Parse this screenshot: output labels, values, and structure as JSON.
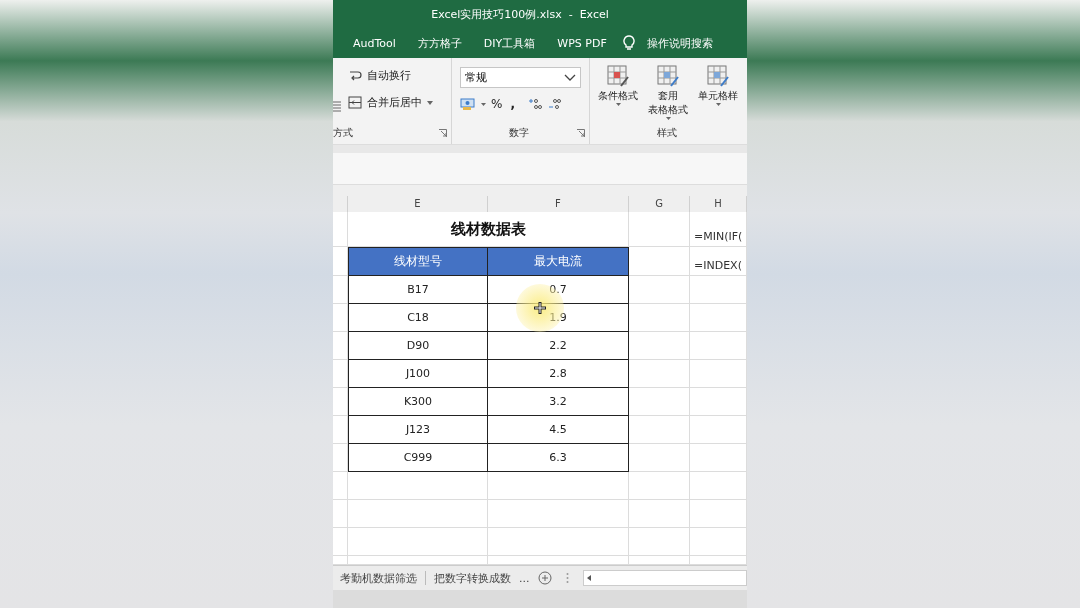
{
  "window": {
    "title": "Excel实用技巧100例.xlsx  -  Excel"
  },
  "ribbon_tabs": [
    "AudTool",
    "方方格子",
    "DIY工具箱",
    "WPS PDF"
  ],
  "tell_me": {
    "placeholder": "操作说明搜索"
  },
  "ribbon": {
    "alignment": {
      "wrap": "自动换行",
      "merge": "合并后居中",
      "label": "方式"
    },
    "number": {
      "format": "常规",
      "percent": "%",
      "comma": ",",
      "label": "数字"
    },
    "styles": {
      "buttons": [
        {
          "lines": [
            "条件格式"
          ]
        },
        {
          "lines": [
            "套用",
            "表格格式"
          ]
        },
        {
          "lines": [
            "单元格样"
          ]
        }
      ],
      "label": "样式"
    }
  },
  "columns": [
    "E",
    "F",
    "G",
    "H"
  ],
  "table": {
    "title": "线材数据表",
    "headers": [
      "线材型号",
      "最大电流"
    ],
    "rows": [
      [
        "B17",
        "0.7"
      ],
      [
        "C18",
        "1.9"
      ],
      [
        "D90",
        "2.2"
      ],
      [
        "J100",
        "2.8"
      ],
      [
        "K300",
        "3.2"
      ],
      [
        "J123",
        "4.5"
      ],
      [
        "C999",
        "6.3"
      ]
    ]
  },
  "formulas": [
    "=MIN(IF(",
    "=INDEX("
  ],
  "sheet_tabs": [
    "考勤机数据筛选",
    "把数字转换成数"
  ],
  "more": "..."
}
